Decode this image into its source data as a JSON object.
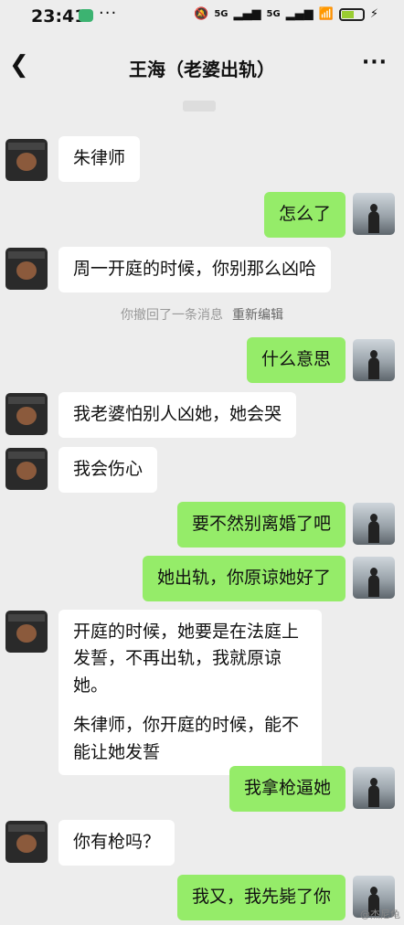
{
  "status": {
    "time": "23:41",
    "more_glyph": "···",
    "signal1": "5G",
    "signal2": "5G",
    "battery_level": 0.6
  },
  "chat": {
    "title": "王海（老婆出轨）",
    "back_icon": "chevron-left-icon",
    "more_icon": "more-dots-icon"
  },
  "recall_notice": {
    "text": "你撤回了一条消息",
    "action": "重新编辑"
  },
  "messages": [
    {
      "side": "left",
      "text": "朱律师"
    },
    {
      "side": "right",
      "text": "怎么了"
    },
    {
      "side": "left",
      "text": "周一开庭的时候，你别那么凶哈"
    },
    {
      "side": "right",
      "text": "什么意思"
    },
    {
      "side": "left",
      "text": "我老婆怕别人凶她，她会哭"
    },
    {
      "side": "left",
      "text": "我会伤心"
    },
    {
      "side": "right",
      "text": "要不然别离婚了吧"
    },
    {
      "side": "right",
      "text": "她出轨，你原谅她好了"
    },
    {
      "side": "left",
      "paragraphs": [
        "开庭的时候，她要是在法庭上发誓，不再出轨，我就原谅她。",
        "朱律师，你开庭的时候，能不能让她发誓"
      ]
    },
    {
      "side": "right",
      "text": "我拿枪逼她"
    },
    {
      "side": "left",
      "text": "你有枪吗？"
    },
    {
      "side": "right",
      "text": "我又，我先毙了你"
    }
  ],
  "watermark": "@杰尼龟"
}
